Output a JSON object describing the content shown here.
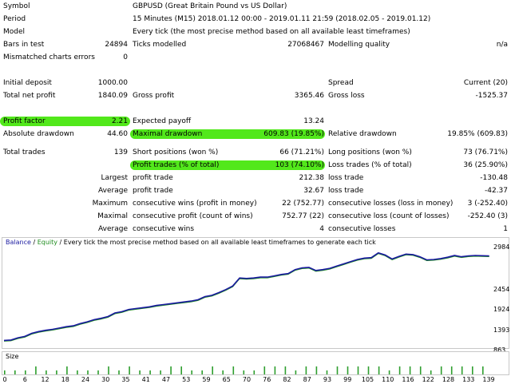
{
  "report": {
    "symbol": {
      "label": "Symbol",
      "value": "GBPUSD (Great Britain Pound vs US Dollar)"
    },
    "period": {
      "label": "Period",
      "value": "15 Minutes (M15) 2018.01.12 00:00 - 2019.01.11 21:59 (2018.02.05 - 2019.01.12)"
    },
    "model": {
      "label": "Model",
      "value": "Every tick (the most precise method based on all available least timeframes)"
    },
    "bars_in_test": {
      "label": "Bars in test",
      "value": "24894"
    },
    "ticks_modelled": {
      "label": "Ticks modelled",
      "value": "27068467"
    },
    "modelling_quality": {
      "label": "Modelling quality",
      "value": "n/a"
    },
    "mismatched_errors": {
      "label": "Mismatched charts errors",
      "value": "0"
    },
    "initial_deposit": {
      "label": "Initial deposit",
      "value": "1000.00"
    },
    "spread": {
      "label": "Spread",
      "value": "Current (20)"
    },
    "total_net_profit": {
      "label": "Total net profit",
      "value": "1840.09"
    },
    "gross_profit": {
      "label": "Gross profit",
      "value": "3365.46"
    },
    "gross_loss": {
      "label": "Gross loss",
      "value": "-1525.37"
    },
    "profit_factor": {
      "label": "Profit factor",
      "value": "2.21"
    },
    "expected_payoff": {
      "label": "Expected payoff",
      "value": "13.24"
    },
    "absolute_drawdown": {
      "label": "Absolute drawdown",
      "value": "44.60"
    },
    "maximal_drawdown": {
      "label": "Maximal drawdown",
      "value": "609.83 (19.85%)"
    },
    "relative_drawdown": {
      "label": "Relative drawdown",
      "value": "19.85% (609.83)"
    },
    "total_trades": {
      "label": "Total trades",
      "value": "139"
    },
    "short_positions": {
      "label": "Short positions (won %)",
      "value": "66 (71.21%)"
    },
    "long_positions": {
      "label": "Long positions (won %)",
      "value": "73 (76.71%)"
    },
    "profit_trades": {
      "label": "Profit trades (% of total)",
      "value": "103 (74.10%)"
    },
    "loss_trades": {
      "label": "Loss trades (% of total)",
      "value": "36 (25.90%)"
    },
    "largest": {
      "label": "Largest",
      "profit_label": "profit trade",
      "profit_value": "212.38",
      "loss_label": "loss trade",
      "loss_value": "-130.48"
    },
    "average": {
      "label": "Average",
      "profit_label": "profit trade",
      "profit_value": "32.67",
      "loss_label": "loss trade",
      "loss_value": "-42.37"
    },
    "maximum": {
      "label": "Maximum",
      "wins_label": "consecutive wins (profit in money)",
      "wins_value": "22 (752.77)",
      "losses_label": "consecutive losses (loss in money)",
      "losses_value": "3 (-252.40)"
    },
    "maximal": {
      "label": "Maximal",
      "wins_label": "consecutive profit (count of wins)",
      "wins_value": "752.77 (22)",
      "losses_label": "consecutive loss (count of losses)",
      "losses_value": "-252.40 (3)"
    },
    "average_consec": {
      "label": "Average",
      "wins_label": "consecutive wins",
      "wins_value": "4",
      "losses_label": "consecutive losses",
      "losses_value": "1"
    }
  },
  "graph": {
    "legend_balance": "Balance",
    "legend_sep1": " / ",
    "legend_equity": "Equity",
    "legend_sep2": " / ",
    "legend_rest": "Every tick  the most precise method based on all available least timeframes to generate each tick",
    "size_label": "Size",
    "colors": {
      "balance": "#1a1aa0",
      "equity": "#1e8c1e",
      "size_bars": "#2e9e2e",
      "highlight": "#52e81b"
    }
  },
  "chart_data": {
    "type": "line",
    "title": "",
    "xlabel": "",
    "ylabel": "",
    "y_ticks": [
      "2984",
      "2454",
      "1924",
      "1393",
      "863"
    ],
    "ylim": [
      863,
      3100
    ],
    "x_ticks": [
      "0",
      "6",
      "12",
      "18",
      "24",
      "30",
      "35",
      "41",
      "47",
      "53",
      "59",
      "65",
      "70",
      "76",
      "82",
      "87",
      "93",
      "99",
      "105",
      "110",
      "116",
      "122",
      "128",
      "133",
      "139"
    ],
    "xlim": [
      0,
      141
    ],
    "series": [
      {
        "name": "Balance",
        "x": [
          0,
          2,
          4,
          6,
          8,
          10,
          12,
          14,
          16,
          18,
          20,
          22,
          24,
          26,
          28,
          30,
          32,
          34,
          36,
          38,
          40,
          42,
          44,
          46,
          48,
          50,
          52,
          54,
          56,
          58,
          60,
          62,
          64,
          66,
          68,
          70,
          72,
          74,
          76,
          78,
          80,
          82,
          84,
          86,
          88,
          90,
          92,
          94,
          96,
          98,
          100,
          102,
          104,
          106,
          108,
          110,
          112,
          114,
          116,
          118,
          120,
          122,
          124,
          126,
          128,
          130,
          132,
          134,
          136,
          138,
          140
        ],
        "values": [
          1000,
          1010,
          1060,
          1090,
          1160,
          1200,
          1230,
          1250,
          1280,
          1310,
          1330,
          1380,
          1420,
          1470,
          1500,
          1540,
          1620,
          1650,
          1700,
          1720,
          1740,
          1760,
          1790,
          1810,
          1830,
          1850,
          1870,
          1890,
          1920,
          1990,
          2020,
          2080,
          2150,
          2230,
          2410,
          2400,
          2410,
          2430,
          2430,
          2460,
          2490,
          2510,
          2600,
          2640,
          2650,
          2580,
          2600,
          2630,
          2680,
          2730,
          2780,
          2830,
          2860,
          2870,
          2980,
          2930,
          2840,
          2900,
          2950,
          2940,
          2890,
          2820,
          2830,
          2850,
          2880,
          2920,
          2890,
          2910,
          2920,
          2915,
          2910
        ]
      }
    ],
    "size_bars": {
      "x": [
        0,
        3,
        6,
        9,
        12,
        15,
        18,
        21,
        24,
        27,
        30,
        33,
        36,
        39,
        42,
        45,
        48,
        51,
        54,
        57,
        60,
        63,
        66,
        69,
        72,
        75,
        78,
        81,
        84,
        87,
        90,
        93,
        96,
        99,
        102,
        105,
        108,
        111,
        114,
        117,
        120,
        123,
        126,
        129,
        132,
        135,
        138
      ],
      "values": [
        1,
        1,
        1,
        2,
        1,
        1,
        2,
        1,
        1,
        1,
        2,
        1,
        2,
        1,
        1,
        1,
        2,
        2,
        1,
        1,
        2,
        1,
        2,
        1,
        1,
        2,
        2,
        2,
        1,
        2,
        2,
        1,
        2,
        2,
        2,
        2,
        2,
        1,
        2,
        2,
        2,
        1,
        2,
        2,
        2,
        2,
        2
      ]
    }
  }
}
